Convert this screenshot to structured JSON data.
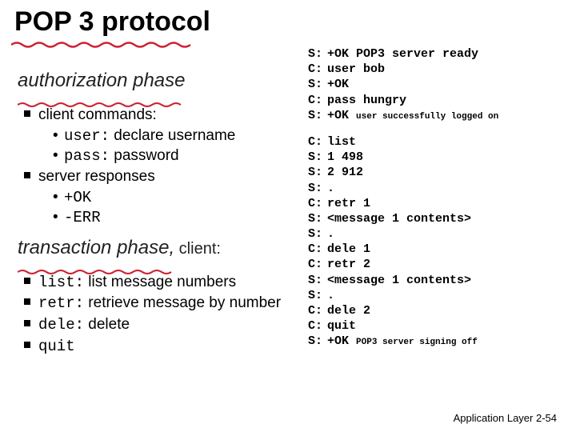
{
  "title": "POP 3 protocol",
  "left": {
    "auth_heading": "authorization phase",
    "client_commands_label": "client commands:",
    "user_cmd": "user:",
    "user_desc": " declare username",
    "pass_cmd": "pass:",
    "pass_desc": " password",
    "server_responses_label": "server responses",
    "ok": "+OK",
    "err": "-ERR",
    "trans_heading": "transaction phase,",
    "trans_suffix": " client:",
    "list_cmd": "list:",
    "list_desc": " list message numbers",
    "retr_cmd": "retr:",
    "retr_desc": " retrieve message by number",
    "dele_cmd": "dele:",
    "dele_desc": " delete",
    "quit_cmd": "quit"
  },
  "session": {
    "auth": [
      {
        "role": "S:",
        "text": "+OK POP3 server ready"
      },
      {
        "role": "C:",
        "text": "user bob"
      },
      {
        "role": "S:",
        "text": "+OK"
      },
      {
        "role": "C:",
        "text": "pass hungry"
      },
      {
        "role": "S:",
        "text": "+OK ",
        "small": "user successfully logged on"
      }
    ],
    "trans": [
      {
        "role": "C:",
        "text": "list"
      },
      {
        "role": "S:",
        "text": "1 498"
      },
      {
        "role": "S:",
        "text": "2 912"
      },
      {
        "role": "S:",
        "text": "."
      },
      {
        "role": "C:",
        "text": "retr 1"
      },
      {
        "role": "S:",
        "text": "<message 1 contents>"
      },
      {
        "role": "S:",
        "text": "."
      },
      {
        "role": "C:",
        "text": "dele 1"
      },
      {
        "role": "C:",
        "text": "retr 2"
      },
      {
        "role": "S:",
        "text": "<message 1 contents>"
      },
      {
        "role": "S:",
        "text": "."
      },
      {
        "role": "C:",
        "text": "dele 2"
      },
      {
        "role": "C:",
        "text": "quit"
      },
      {
        "role": "S:",
        "text": "+OK ",
        "small": "POP3 server signing off"
      }
    ]
  },
  "footer": {
    "chapter": "Application Layer ",
    "page": "2-54"
  }
}
